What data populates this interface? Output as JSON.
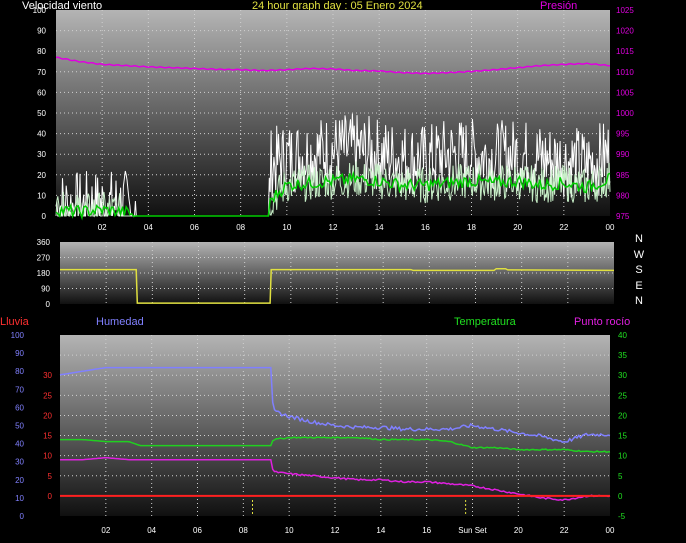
{
  "header": {
    "wind_label": "Velocidad viento",
    "graph_title": "24 hour graph day : 05 Enero 2024",
    "pressure_label": "Presión",
    "rain_label": "Lluvia",
    "humidity_label": "Humedad",
    "temperature_label": "Temperatura",
    "dewpoint_label": "Punto rocío"
  },
  "colors": {
    "wind_gust": "#ffffff",
    "wind_avg": "#c8f0c8",
    "wind_avg_smooth": "#00cc00",
    "pressure": "#e000e0",
    "direction": "#e0e040",
    "humidity": "#8080ff",
    "temperature": "#20d020",
    "dewpoint": "#e020e0",
    "rain": "#ff2020",
    "axis_wind": "#ffffff",
    "axis_pressure": "#e000e0",
    "axis_rain": "#ff3030",
    "axis_humidity": "#8080ff",
    "axis_temp": "#20e020"
  },
  "chart_data": [
    {
      "type": "line",
      "name": "wind_pressure",
      "title": "24 hour graph day : 05 Enero 2024",
      "x_ticks": [
        "02",
        "04",
        "06",
        "08",
        "10",
        "12",
        "14",
        "16",
        "18",
        "20",
        "22",
        "00"
      ],
      "ylim_left": [
        0,
        100
      ],
      "yticks_left": [
        "0",
        "10",
        "20",
        "30",
        "40",
        "50",
        "60",
        "70",
        "80",
        "90",
        "100"
      ],
      "ylim_right": [
        975,
        1025
      ],
      "yticks_right": [
        "975",
        "980",
        "985",
        "990",
        "995",
        "1000",
        "1005",
        "1010",
        "1015",
        "1020",
        "1025"
      ],
      "grid": true,
      "series": [
        {
          "name": "Velocidad viento",
          "axis": "left",
          "style": "gust",
          "x": [
            0,
            1,
            2,
            3,
            3.5,
            9.2,
            9.3,
            10,
            11,
            12,
            13,
            14,
            15,
            16,
            17,
            18,
            19,
            20,
            21,
            22,
            23,
            24
          ],
          "y": [
            5,
            4,
            5,
            5,
            0,
            0,
            25,
            28,
            30,
            32,
            32,
            30,
            28,
            27,
            30,
            30,
            28,
            30,
            28,
            27,
            25,
            30
          ]
        },
        {
          "name": "Velocidad viento",
          "axis": "left",
          "style": "avg",
          "x": [
            0,
            1,
            2,
            3,
            3.5,
            9.2,
            9.3,
            10,
            11,
            12,
            13,
            14,
            15,
            16,
            17,
            18,
            19,
            20,
            21,
            22,
            23,
            24
          ],
          "y": [
            3,
            2,
            3,
            2,
            0,
            0,
            8,
            15,
            16,
            17,
            18,
            17,
            15,
            15,
            16,
            17,
            16,
            17,
            15,
            16,
            14,
            18
          ]
        },
        {
          "name": "Presión",
          "axis": "right",
          "x": [
            0,
            1,
            2,
            3,
            4,
            5,
            6,
            7,
            8,
            9,
            10,
            11,
            12,
            13,
            14,
            15,
            16,
            17,
            18,
            19,
            20,
            21,
            22,
            23,
            24
          ],
          "y": [
            1013.5,
            1012.5,
            1011.8,
            1011.5,
            1011.2,
            1011,
            1010.8,
            1010.6,
            1010.5,
            1010.3,
            1010.5,
            1010.8,
            1010.7,
            1010.3,
            1010.2,
            1009.8,
            1009.6,
            1009.8,
            1010.1,
            1010.5,
            1011,
            1011.5,
            1011.8,
            1012,
            1011.5
          ]
        }
      ]
    },
    {
      "type": "line",
      "name": "wind_direction",
      "x_ticks": [],
      "ylim": [
        0,
        360
      ],
      "yticks": [
        "0",
        "90",
        "180",
        "270",
        "360"
      ],
      "right_labels": [
        "N",
        "W",
        "S",
        "E",
        "N"
      ],
      "grid": true,
      "series": [
        {
          "name": "Dirección",
          "x": [
            0,
            3.3,
            3.35,
            9.1,
            9.15,
            15.2,
            15.3,
            18.8,
            18.9,
            19.3,
            19.4,
            24
          ],
          "y": [
            200,
            200,
            5,
            5,
            200,
            200,
            195,
            195,
            205,
            205,
            198,
            195
          ]
        }
      ]
    },
    {
      "type": "line",
      "name": "rain_humidity_temp",
      "x_ticks": [
        "02",
        "04",
        "06",
        "08",
        "10",
        "12",
        "14",
        "16",
        "Sun Set",
        "20",
        "22",
        "00"
      ],
      "ylim_left": [
        0,
        30
      ],
      "yticks_left": [
        "0",
        "5",
        "10",
        "15",
        "20",
        "25",
        "30"
      ],
      "ylim_humidity": [
        0,
        100
      ],
      "yticks_humidity": [
        "0",
        "10",
        "20",
        "30",
        "40",
        "50",
        "60",
        "70",
        "80",
        "90",
        "100"
      ],
      "ylim_right": [
        -5,
        40
      ],
      "yticks_right": [
        "-5",
        "0",
        "5",
        "10",
        "15",
        "20",
        "25",
        "30",
        "35",
        "40"
      ],
      "grid": true,
      "series": [
        {
          "name": "Humedad",
          "axis": "humidity",
          "x": [
            0,
            1,
            2,
            3,
            3.5,
            4,
            6,
            8,
            9.2,
            9.3,
            10,
            11,
            12,
            13,
            14,
            15,
            16,
            17,
            18,
            19,
            20,
            21,
            22,
            23,
            24
          ],
          "y": [
            78,
            80,
            82,
            82,
            82,
            82,
            82,
            82,
            82,
            58,
            55,
            52,
            50,
            49,
            49,
            48,
            48,
            48,
            50,
            48,
            46,
            44,
            41,
            45,
            45
          ]
        },
        {
          "name": "Temperatura",
          "axis": "right",
          "x": [
            0,
            1,
            2,
            3,
            3.5,
            4,
            6,
            8,
            9.2,
            9.3,
            10,
            11,
            12,
            13,
            14,
            15,
            16,
            17,
            18,
            19,
            20,
            21,
            22,
            23,
            24
          ],
          "y": [
            14,
            14,
            13.5,
            13.5,
            12.5,
            12.5,
            12.5,
            12.5,
            12.5,
            14,
            14.5,
            14.5,
            14.5,
            14.5,
            14,
            14,
            14,
            13.5,
            12,
            12,
            11.5,
            11.5,
            11.5,
            11,
            11
          ]
        },
        {
          "name": "Punto rocío",
          "axis": "right",
          "x": [
            0,
            1,
            2,
            3,
            3.5,
            4,
            6,
            8,
            9.2,
            9.3,
            10,
            11,
            12,
            13,
            14,
            15,
            16,
            17,
            18,
            19,
            20,
            21,
            22,
            23,
            24
          ],
          "y": [
            9,
            9,
            9.5,
            9,
            9,
            9,
            9,
            9,
            9,
            6,
            5.5,
            5,
            4.5,
            4,
            4,
            3.5,
            3.5,
            3,
            2.5,
            1.5,
            0.5,
            -0.5,
            -1,
            0,
            0
          ]
        },
        {
          "name": "Lluvia",
          "axis": "left",
          "x": [
            0,
            24
          ],
          "y": [
            0,
            0
          ]
        }
      ],
      "markers": [
        {
          "name": "sunrise",
          "x": 8.4
        },
        {
          "name": "sunset",
          "x": 17.7
        }
      ]
    }
  ]
}
